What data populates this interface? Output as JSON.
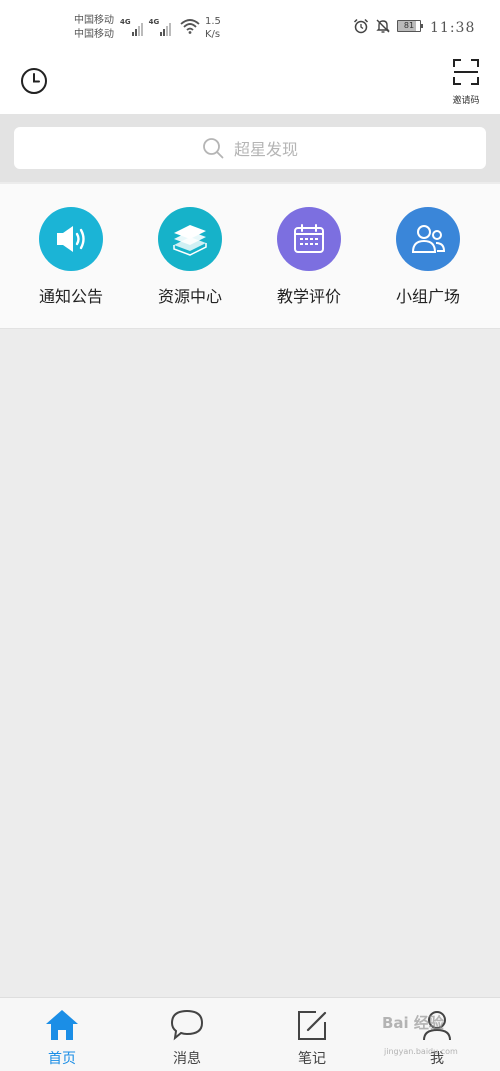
{
  "status_bar": {
    "carrier_1": "中国移动",
    "carrier_2": "中国移动",
    "net_1": "4G",
    "net_2": "4G",
    "speed_value": "1.5",
    "speed_unit": "K/s",
    "battery": "81",
    "time": "11:38"
  },
  "top_bar": {
    "invite_label": "邀请码"
  },
  "search": {
    "placeholder": "超星发现"
  },
  "entries": [
    {
      "label": "通知公告",
      "icon": "speaker-icon",
      "color": "#1bb4d6"
    },
    {
      "label": "资源中心",
      "icon": "stack-books-icon",
      "color": "#16b2c9"
    },
    {
      "label": "教学评价",
      "icon": "calendar-icon",
      "color": "#7c6fe0"
    },
    {
      "label": "小组广场",
      "icon": "group-people-icon",
      "color": "#3a86d9"
    }
  ],
  "bottom_nav": [
    {
      "label": "首页",
      "icon": "home-icon",
      "active": true
    },
    {
      "label": "消息",
      "icon": "chat-bubble-icon",
      "active": false
    },
    {
      "label": "笔记",
      "icon": "note-edit-icon",
      "active": false
    },
    {
      "label": "我",
      "icon": "user-icon",
      "active": false
    }
  ],
  "accent_color": "#1b8ee6",
  "watermark": {
    "text": "Bai 经验",
    "sub": "jingyan.baidu.com"
  }
}
